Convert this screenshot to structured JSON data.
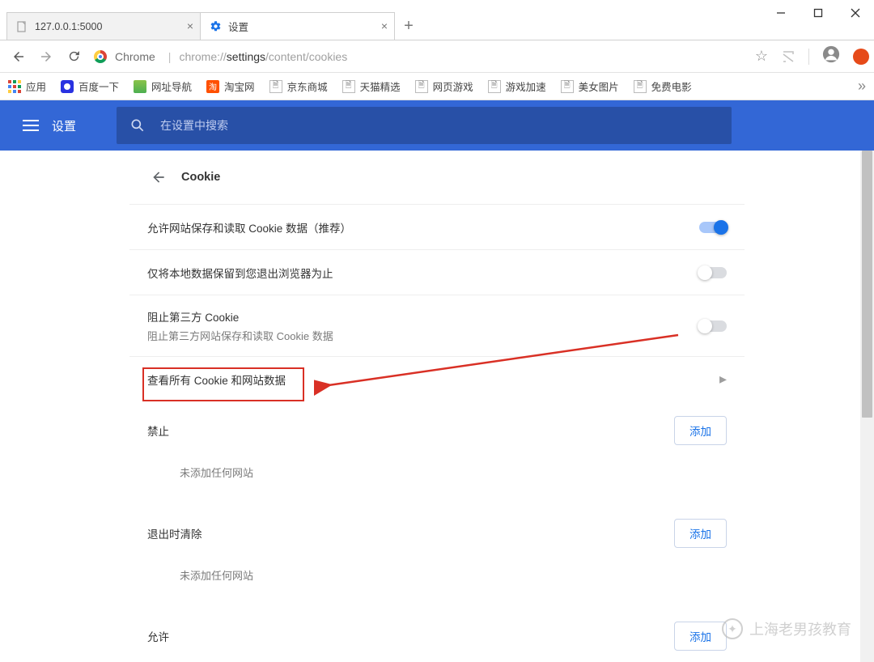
{
  "window": {
    "minimize": "—",
    "maximize": "▢",
    "close": "✕"
  },
  "tabs": [
    {
      "title": "127.0.0.1:5000",
      "active": false
    },
    {
      "title": "设置",
      "active": true
    }
  ],
  "omnibox": {
    "product_label": "Chrome",
    "url_dim_pre": "chrome://",
    "url_strong": "settings",
    "url_dim_post": "/content/cookies"
  },
  "bookmarks": {
    "apps": "应用",
    "items": [
      "百度一下",
      "网址导航",
      "淘宝网",
      "京东商城",
      "天猫精选",
      "网页游戏",
      "游戏加速",
      "美女图片",
      "免费电影"
    ]
  },
  "settings_header": {
    "title": "设置",
    "search_placeholder": "在设置中搜索"
  },
  "page": {
    "section_title": "Cookie",
    "toggles": [
      {
        "title": "允许网站保存和读取 Cookie 数据（推荐）",
        "sub": "",
        "on": true
      },
      {
        "title": "仅将本地数据保留到您退出浏览器为止",
        "sub": "",
        "on": false
      },
      {
        "title": "阻止第三方 Cookie",
        "sub": "阻止第三方网站保存和读取 Cookie 数据",
        "on": false
      }
    ],
    "link_row": "查看所有 Cookie 和网站数据",
    "lists": [
      {
        "title": "禁止",
        "add": "添加",
        "empty": "未添加任何网站"
      },
      {
        "title": "退出时清除",
        "add": "添加",
        "empty": "未添加任何网站"
      },
      {
        "title": "允许",
        "add": "添加",
        "empty": ""
      }
    ]
  },
  "watermark": "上海老男孩教育"
}
